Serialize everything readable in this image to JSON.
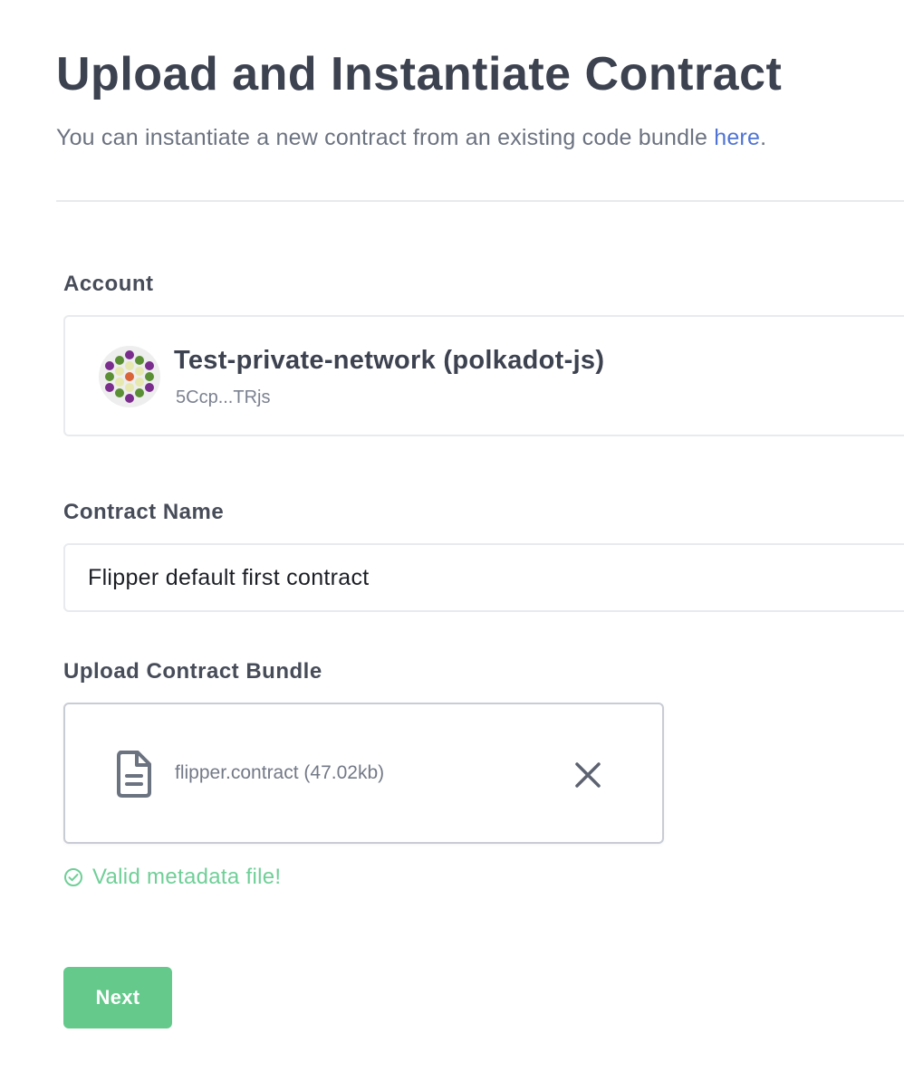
{
  "header": {
    "title": "Upload and Instantiate Contract",
    "subtitle_prefix": "You can instantiate a new contract from an existing code bundle ",
    "subtitle_link": "here",
    "subtitle_suffix": "."
  },
  "account": {
    "label": "Account",
    "name": "Test-private-network (polkadot-js)",
    "address": "5Ccp...TRjs",
    "avatar_icon": "polkadot-identicon"
  },
  "contract_name": {
    "label": "Contract Name",
    "value": "Flipper default first contract"
  },
  "upload": {
    "label": "Upload Contract Bundle",
    "file_name": "flipper.contract (47.02kb)",
    "file_icon": "document-icon",
    "remove_icon": "close-icon"
  },
  "validation": {
    "icon": "check-circle-icon",
    "message": "Valid metadata file!",
    "color": "#6fcf97"
  },
  "actions": {
    "next_label": "Next",
    "next_color": "#64c98b"
  },
  "colors": {
    "link": "#4f74d6",
    "heading": "#3d4250"
  }
}
